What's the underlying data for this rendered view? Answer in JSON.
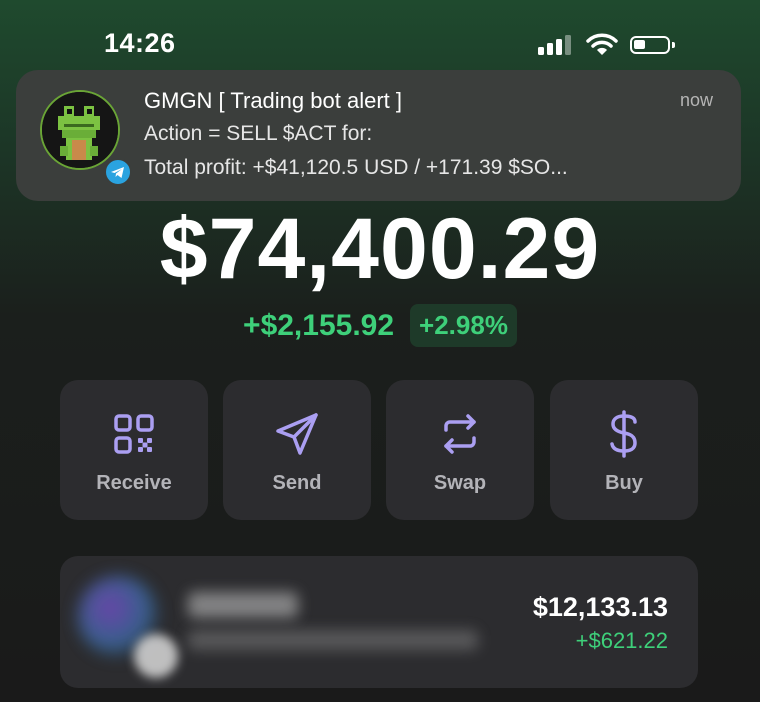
{
  "status_bar": {
    "time": "14:26",
    "icons": [
      "signal-icon",
      "wifi-icon",
      "battery-icon"
    ]
  },
  "notification": {
    "app_icon": "frog-avatar-icon",
    "badge_icon": "telegram-icon",
    "title": "GMGN [ Trading bot alert ]",
    "line1": "Action = SELL $ACT for:",
    "line2": "Total profit: +$41,120.5 USD / +171.39 $SO...",
    "time": "now"
  },
  "wallet": {
    "balance": "$74,400.29",
    "change_amount": "+$2,155.92",
    "change_percent": "+2.98%"
  },
  "actions": [
    {
      "label": "Receive",
      "icon": "qr-code-icon"
    },
    {
      "label": "Send",
      "icon": "send-icon"
    },
    {
      "label": "Swap",
      "icon": "swap-icon"
    },
    {
      "label": "Buy",
      "icon": "dollar-icon"
    }
  ],
  "token": {
    "value": "$12,133.13",
    "change": "+$621.22"
  },
  "colors": {
    "accent_green": "#3ed07a",
    "icon_purple": "#ab9ff2",
    "card_bg": "#2c2c2f",
    "notification_bg": "#3b3e3c"
  }
}
